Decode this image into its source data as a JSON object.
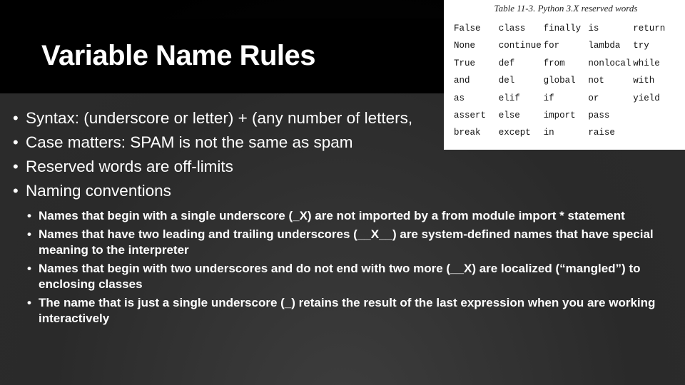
{
  "title": "Variable Name Rules",
  "bullets": {
    "main": [
      "Syntax: (underscore or letter) + (any number of letters,",
      "Case matters: SPAM is not the same as spam",
      "Reserved words are off-limits",
      "Naming conventions"
    ],
    "sub": [
      "Names that begin with a single underscore (_X) are not  imported by a from module import * statement",
      "Names that have two leading and trailing underscores (__X__) are system-defined names that have special meaning to the interpreter",
      "Names that begin with two underscores and do not end with two more (__X) are localized (“mangled”) to enclosing classes",
      "The name that is just a single underscore (_) retains the result of the last expression when you are working interactively"
    ]
  },
  "table": {
    "caption": "Table 11-3. Python 3.X reserved words",
    "columns": [
      [
        "False",
        "None",
        "True",
        "and",
        "as",
        "assert",
        "break"
      ],
      [
        "class",
        "continue",
        "def",
        "del",
        "elif",
        "else",
        "except"
      ],
      [
        "finally",
        "for",
        "from",
        "global",
        "if",
        "import",
        "in"
      ],
      [
        "is",
        "lambda",
        "nonlocal",
        "not",
        "or",
        "pass",
        "raise"
      ],
      [
        "return",
        "try",
        "while",
        "with",
        "yield"
      ]
    ]
  }
}
